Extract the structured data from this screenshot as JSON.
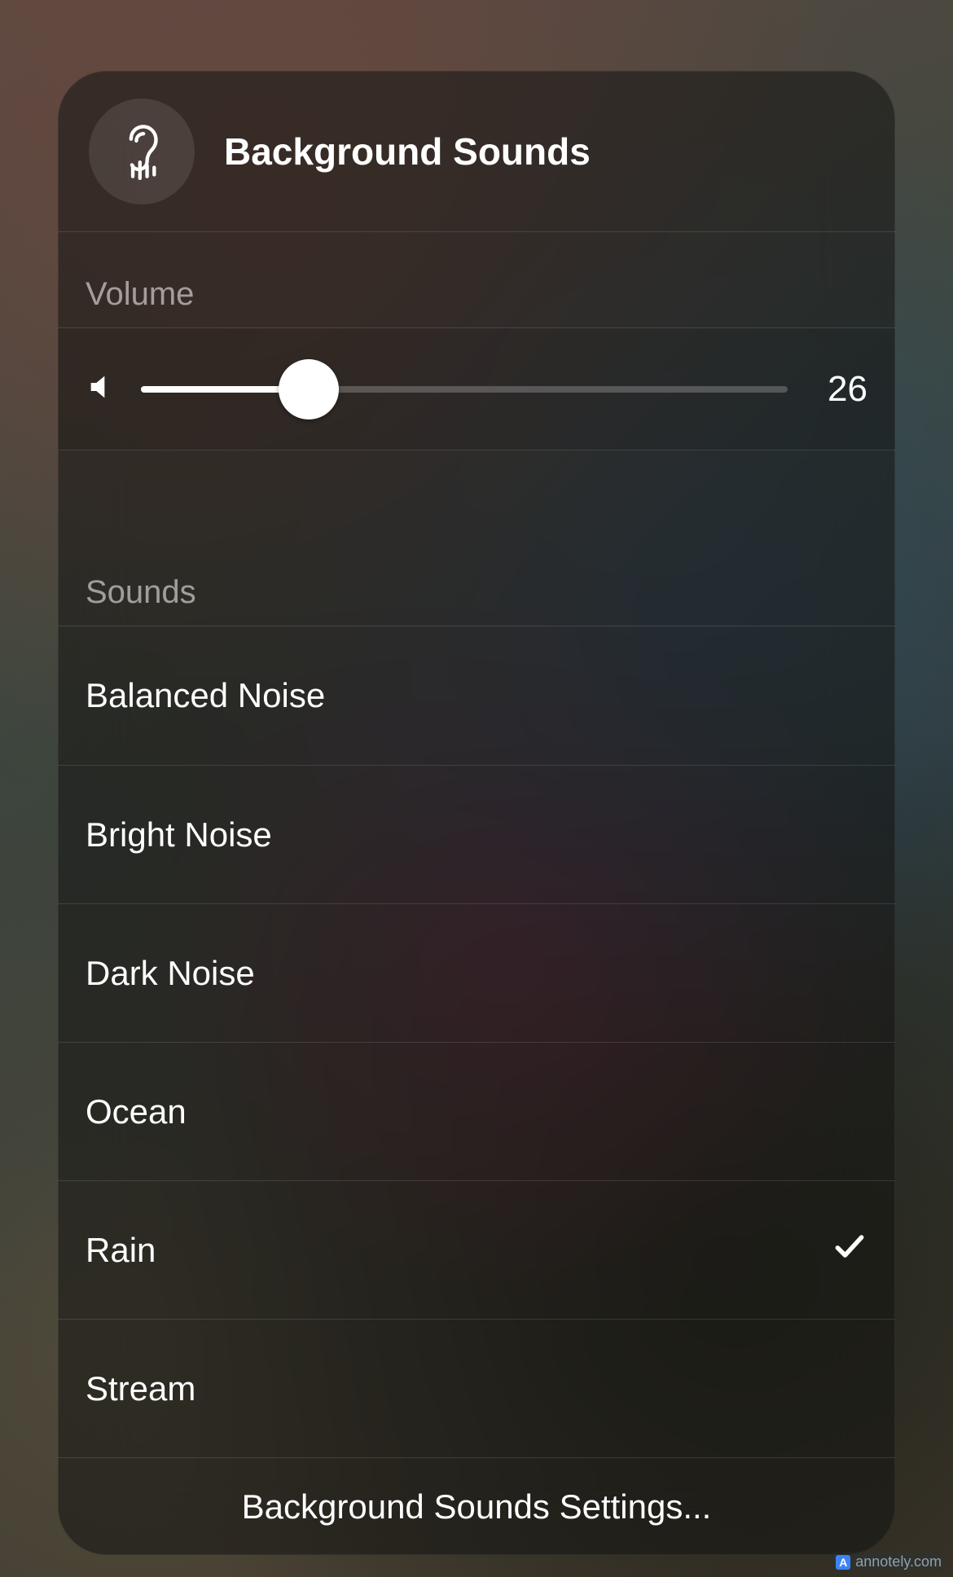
{
  "header": {
    "icon_name": "ear-sound-icon",
    "title": "Background Sounds"
  },
  "volume": {
    "label": "Volume",
    "value": 26,
    "min": 0,
    "max": 100
  },
  "sounds": {
    "label": "Sounds",
    "options": [
      {
        "label": "Balanced Noise",
        "selected": false
      },
      {
        "label": "Bright Noise",
        "selected": false
      },
      {
        "label": "Dark Noise",
        "selected": false
      },
      {
        "label": "Ocean",
        "selected": false
      },
      {
        "label": "Rain",
        "selected": true
      },
      {
        "label": "Stream",
        "selected": false
      }
    ]
  },
  "footer": {
    "settings_label": "Background Sounds Settings..."
  },
  "watermark": {
    "text": "annotely.com"
  }
}
